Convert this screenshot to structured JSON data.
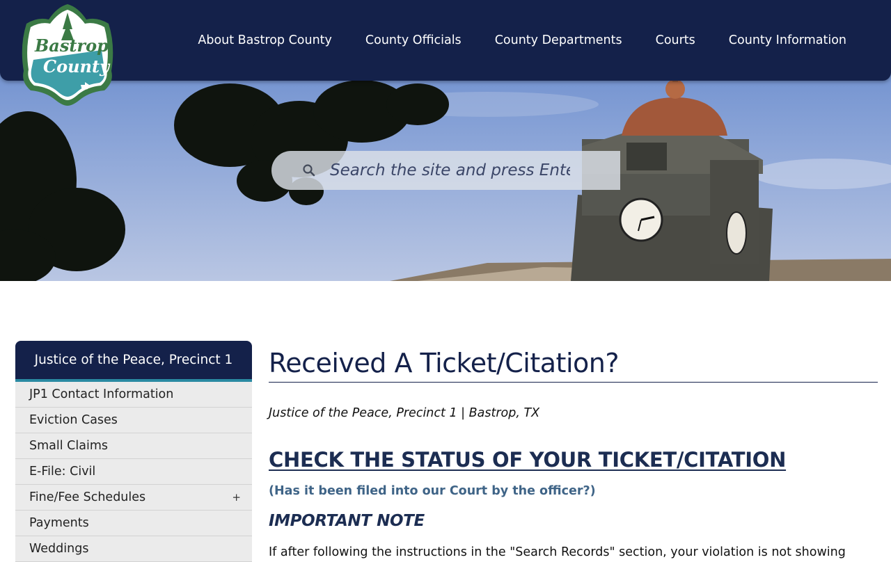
{
  "header": {
    "logo_text_line1": "Bastrop",
    "logo_text_line2": "County",
    "nav": [
      "About Bastrop County",
      "County Officials",
      "County Departments",
      "Courts",
      "County Information"
    ]
  },
  "search": {
    "placeholder": "Search the site and press Enter"
  },
  "sidebar": {
    "title": "Justice of the Peace, Precinct 1",
    "items": [
      {
        "label": "JP1 Contact Information"
      },
      {
        "label": "Eviction Cases"
      },
      {
        "label": "Small Claims"
      },
      {
        "label": "E-File: Civil"
      },
      {
        "label": "Fine/Fee Schedules",
        "expand": "+"
      },
      {
        "label": "Payments"
      },
      {
        "label": "Weddings"
      }
    ]
  },
  "main": {
    "title": "Received A Ticket/Citation?",
    "subtitle": "Justice of the Peace, Precinct 1 | Bastrop, TX",
    "section_heading": "CHECK THE STATUS OF YOUR TICKET/CITATION",
    "section_sub": "(Has it been filed into our Court by the officer?)",
    "important": "IMPORTANT NOTE",
    "body_partial": "If after following the instructions in the \"Search Records\" section, your violation is not showing"
  },
  "colors": {
    "navy": "#14214a",
    "teal_accent": "#2a8aa2",
    "heading": "#1c2d52",
    "sub_heading": "#3f6487"
  },
  "icons": {
    "search": "search-icon",
    "logo": "bastrop-county-logo"
  }
}
